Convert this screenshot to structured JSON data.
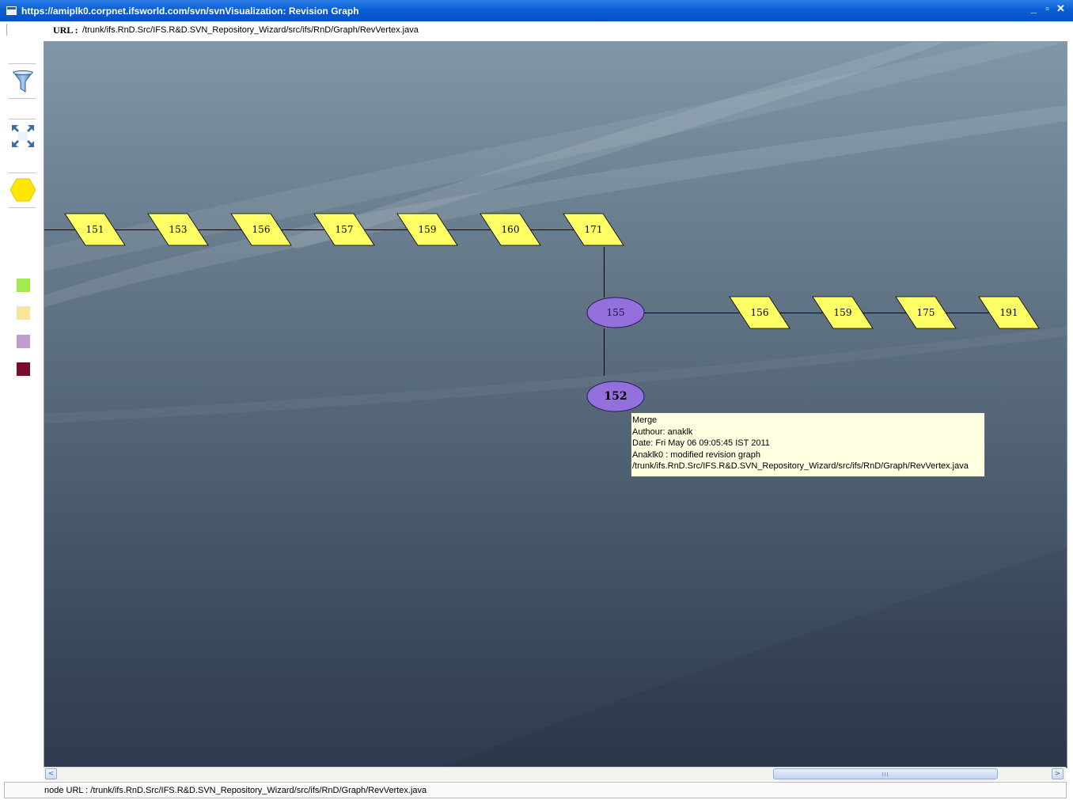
{
  "window": {
    "title": "https://amiplk0.corpnet.ifsworld.com/svn/svnVisualization: Revision Graph",
    "controls": [
      "_",
      "▫",
      "✕"
    ]
  },
  "url_bar": {
    "label": "URL :",
    "value": "/trunk/ifs.RnD.Src/IFS.R&D.SVN_Repository_Wizard/src/ifs/RnD/Graph/RevVertex.java"
  },
  "toolbar": {
    "tools": [
      {
        "name": "filter-icon"
      },
      {
        "name": "fit-to-screen-icon"
      },
      {
        "name": "hexagon-icon",
        "color": "#ffe600"
      }
    ],
    "legend_colors": [
      "#a4ea4f",
      "#f6e89a",
      "#c39bd1",
      "#7a0d2a"
    ]
  },
  "graph": {
    "top_branch": [
      "151",
      "153",
      "156",
      "157",
      "159",
      "160",
      "171"
    ],
    "merge_node": "155",
    "side_branch": [
      "156",
      "159",
      "175",
      "191"
    ],
    "selected_node": "152",
    "revision_color": "#ffff66",
    "merge_color": "#9370db"
  },
  "tooltip": {
    "line1": "Merge",
    "line2": "Authour: anaklk",
    "line3": "Date: Fri May 06 09:05:45 IST 2011",
    "line4": "Anaklk0 : modified revision graph",
    "line5": "/trunk/ifs.RnD.Src/IFS.R&D.SVN_Repository_Wizard/src/ifs/RnD/Graph/RevVertex.java"
  },
  "scrollbar": {
    "left_arrow": "<",
    "right_arrow": ">"
  },
  "status": {
    "text": "node URL : /trunk/ifs.RnD.Src/IFS.R&D.SVN_Repository_Wizard/src/ifs/RnD/Graph/RevVertex.java"
  }
}
